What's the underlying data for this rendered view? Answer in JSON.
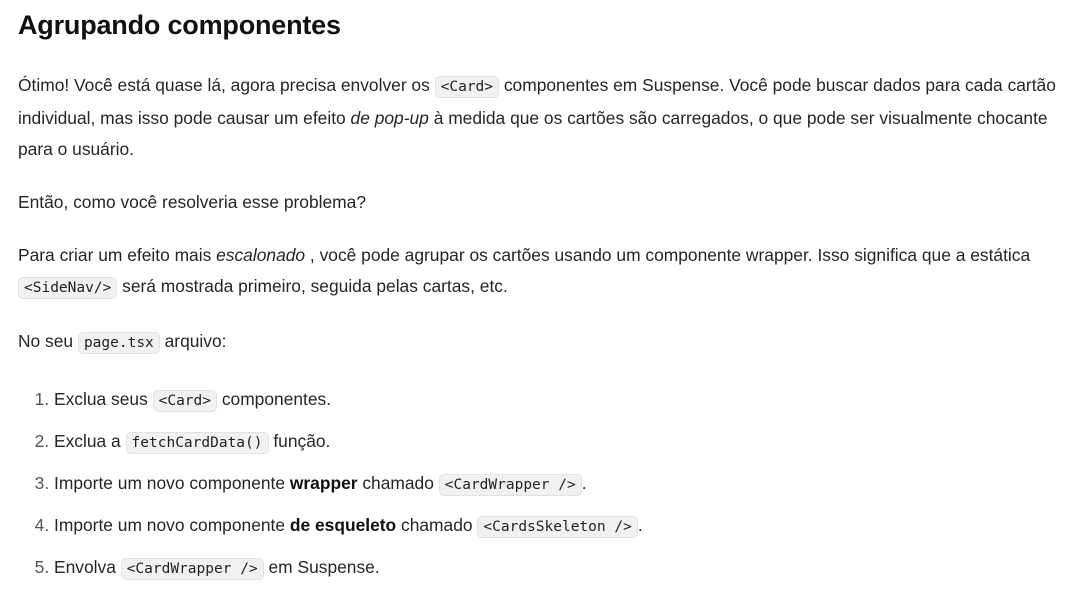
{
  "title": "Agrupando componentes",
  "intro": {
    "t1": "Ótimo! Você está quase lá, agora precisa envolver os ",
    "code1": "<Card>",
    "t2": " componentes em Suspense. Você pode buscar dados para cada cartão individual, mas isso pode causar um efeito ",
    "em1": "de pop-up",
    "t3": " à medida que os cartões são carregados, o que pode ser visualmente chocante para o usuário."
  },
  "question": "Então, como você resolveria esse problema?",
  "approach": {
    "t1": "Para criar um efeito mais ",
    "em1": "escalonado",
    "t2": " , você pode agrupar os cartões usando um componente wrapper. Isso significa que a estática ",
    "code1": "<SideNav/>",
    "t3": " será mostrada primeiro, seguida pelas cartas, etc."
  },
  "file_line": {
    "t1": "No seu ",
    "code1": "page.tsx",
    "t2": " arquivo:"
  },
  "steps": [
    {
      "t1": "Exclua seus ",
      "code": "<Card>",
      "t2": " componentes."
    },
    {
      "t1": "Exclua a ",
      "code": "fetchCardData()",
      "t2": " função."
    },
    {
      "t1": "Importe um novo componente ",
      "strong": "wrapper",
      "t2": " chamado ",
      "code": "<CardWrapper />",
      "t3": "."
    },
    {
      "t1": "Importe um novo componente ",
      "strong": "de esqueleto",
      "t2": " chamado ",
      "code": "<CardsSkeleton />",
      "t3": "."
    },
    {
      "t1": "Envolva ",
      "code": "<CardWrapper />",
      "t2": " em Suspense."
    }
  ]
}
